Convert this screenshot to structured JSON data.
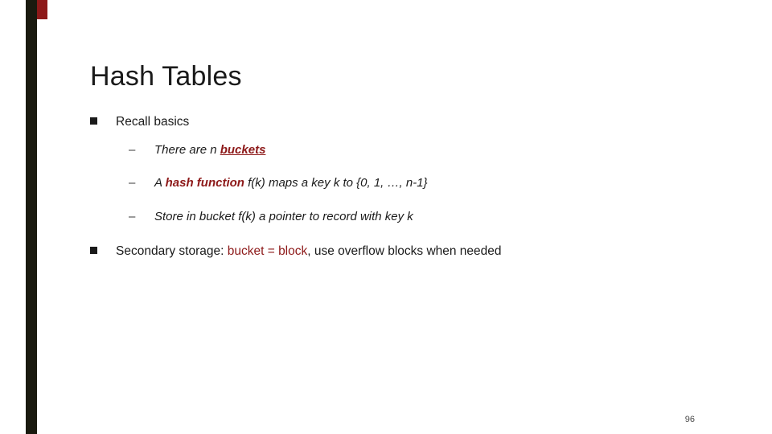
{
  "slide": {
    "title": "Hash Tables",
    "page_number": "96",
    "accent_color": "#8d1919",
    "bar_color": "#1a1a0f",
    "bullets": [
      {
        "level": 1,
        "marker": "square-bullet",
        "text": "Recall basics"
      },
      {
        "level": 2,
        "marker": "dash-bullet",
        "segments": [
          {
            "text": "There are n ",
            "style": "italic"
          },
          {
            "text": "buckets",
            "style": "accent-bold-underline"
          }
        ],
        "plain_text": "There are n buckets"
      },
      {
        "level": 2,
        "marker": "dash-bullet",
        "segments": [
          {
            "text": "A ",
            "style": "italic"
          },
          {
            "text": "hash function",
            "style": "accent-bold"
          },
          {
            "text": " f(k) maps a key k to {0, 1, …, n-1}",
            "style": "italic"
          }
        ],
        "plain_text": "A hash function f(k) maps a key k to {0, 1, …, n-1}"
      },
      {
        "level": 2,
        "marker": "dash-bullet",
        "segments": [
          {
            "text": "Store in bucket f(k) a pointer to record with key k",
            "style": "italic"
          }
        ],
        "plain_text": "Store in bucket f(k) a pointer to record with key k"
      },
      {
        "level": 1,
        "marker": "square-bullet",
        "segments": [
          {
            "text": "Secondary storage: ",
            "style": "normal"
          },
          {
            "text": "bucket = block",
            "style": "accent"
          },
          {
            "text": ", use overflow blocks when needed",
            "style": "normal"
          }
        ],
        "plain_text": "Secondary storage: bucket = block, use overflow blocks when needed"
      }
    ],
    "text_parts": {
      "b1_label": "Recall basics",
      "b2a_pre": "There are n ",
      "b2a_kw": "buckets",
      "b3a_pre": "A ",
      "b3a_kw": "hash function",
      "b3a_post": " f(k) maps a key k to {0, 1, …, n-1}",
      "b4a_text": "Store in bucket f(k) a pointer to record with key k",
      "b5a_pre": "Secondary storage: ",
      "b5a_kw": "bucket = block",
      "b5a_post": ", use overflow blocks when needed",
      "dash": "–",
      "square": ""
    }
  }
}
